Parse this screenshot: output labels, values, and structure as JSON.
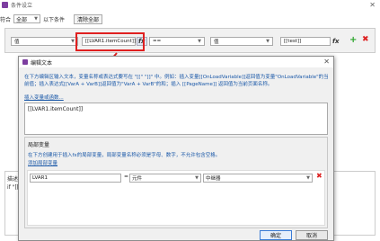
{
  "window": {
    "title": "条件设立",
    "close": "✕"
  },
  "condition": {
    "match_label": "符合",
    "match_value": "全部",
    "suffix": "以下条件",
    "clear_button": "清除全部"
  },
  "rule": {
    "left_type": "值",
    "left_value": "[[LVAR1.itemCount]]",
    "operator": "==",
    "right_type": "值",
    "right_value": "[[test]]",
    "fx": "fx"
  },
  "description": {
    "label": "描述",
    "text": "if \"[["
  },
  "dialog": {
    "title": "编辑文本",
    "close": "✕",
    "instruction": "在下方编辑区输入文本，变量名称或表达式要写在 \"[[\" \"]]\" 中。例如：插入变量[[OnLoadVariable]]返回值为变量\"OnLoadVariable\"的当前值；插入表达式[[VarA + VarB]]返回值为\"VarA + VarB\"的和；插入 [[PageName]] 返回值为当前页面名称。",
    "insert_link": "插入变量或函数...",
    "expression": "[[LVAR1.itemCount]]",
    "local_vars": {
      "title": "局部变量",
      "desc": "在下方创建用于插入fx的局部变量，局部变量名称必须是字母、数字，不允许包含空格。",
      "add_link": "添加局部变量",
      "rows": [
        {
          "name": "LVAR1",
          "eq": "=",
          "type": "元件",
          "target": "中继器"
        }
      ]
    },
    "ok": "确定",
    "cancel": "取消"
  }
}
